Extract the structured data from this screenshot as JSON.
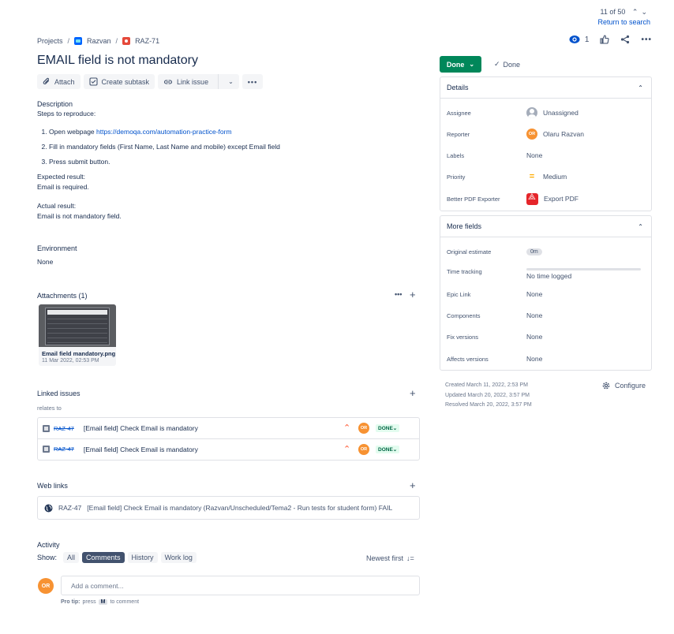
{
  "pager": {
    "count": "11 of 50",
    "return_label": "Return to search"
  },
  "breadcrumb": {
    "projects": "Projects",
    "project": "Razvan",
    "issue_key": "RAZ-71"
  },
  "watchers": {
    "count": "1"
  },
  "issue": {
    "title": "EMAIL field is not mandatory"
  },
  "toolbar": {
    "attach": "Attach",
    "create_subtask": "Create subtask",
    "link_issue": "Link issue"
  },
  "description": {
    "label": "Description",
    "intro": "Steps to reproduce:",
    "step1_prefix": "Open webpage ",
    "step1_link": "https://demoqa.com/automation-practice-form",
    "step2": "Fill in mandatory fields (First Name, Last Name and mobile) except Email field",
    "step3": "Press submit button.",
    "expected_label": "Expected result:",
    "expected_value": "Email is required.",
    "actual_label": "Actual result:",
    "actual_value": "Email is not mandatory field."
  },
  "environment": {
    "label": "Environment",
    "value": "None"
  },
  "attachments": {
    "label": "Attachments (1)",
    "file_name": "Email field mandatory.png",
    "file_date": "11 Mar 2022, 02:53 PM"
  },
  "linked": {
    "label": "Linked issues",
    "relation": "relates to",
    "rows": [
      {
        "key": "RAZ-47",
        "summary": "[Email field] Check Email is mandatory",
        "assignee": "OR",
        "status": "DONE"
      },
      {
        "key": "RAZ-47",
        "summary": "[Email field] Check Email is mandatory",
        "assignee": "OR",
        "status": "DONE"
      }
    ]
  },
  "weblinks": {
    "label": "Web links",
    "key": "RAZ-47",
    "text": "[Email field] Check Email is mandatory (Razvan/Unscheduled/Tema2 - Run tests for student form) FAIL"
  },
  "activity": {
    "label": "Activity",
    "show_label": "Show:",
    "tabs": [
      "All",
      "Comments",
      "History",
      "Work log"
    ],
    "sort": "Newest first",
    "avatar": "OR",
    "comment_placeholder": "Add a comment...",
    "tip_prefix": "Pro tip:",
    "tip_press": "press",
    "tip_key": "M",
    "tip_suffix": "to comment"
  },
  "status": {
    "button": "Done",
    "resolution": "Done",
    "color": "#00875a"
  },
  "details": {
    "header": "Details",
    "assignee_label": "Assignee",
    "assignee_value": "Unassigned",
    "reporter_label": "Reporter",
    "reporter_value": "Olaru Razvan",
    "reporter_initials": "OR",
    "labels_label": "Labels",
    "labels_value": "None",
    "priority_label": "Priority",
    "priority_value": "Medium",
    "pdf_label": "Better PDF Exporter",
    "pdf_value": "Export PDF"
  },
  "more_fields": {
    "header": "More fields",
    "original_label": "Original estimate",
    "original_value": "0m",
    "tracking_label": "Time tracking",
    "tracking_value": "No time logged",
    "epic_label": "Epic Link",
    "epic_value": "None",
    "components_label": "Components",
    "components_value": "None",
    "fix_label": "Fix versions",
    "fix_value": "None",
    "affects_label": "Affects versions",
    "affects_value": "None"
  },
  "meta": {
    "created": "Created March 11, 2022, 2:53 PM",
    "updated": "Updated March 20, 2022, 3:57 PM",
    "resolved": "Resolved March 20, 2022, 3:57 PM",
    "configure": "Configure"
  }
}
